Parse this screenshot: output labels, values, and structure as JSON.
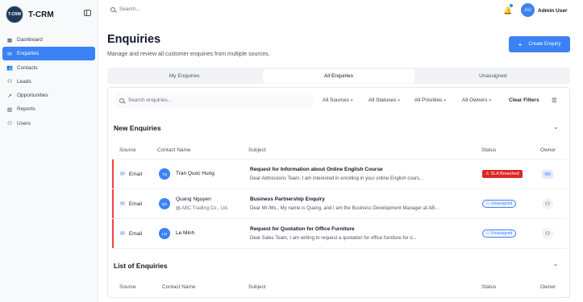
{
  "app": {
    "name": "T-CRM",
    "logo_text": "T-CRM"
  },
  "sidebar": {
    "items": [
      {
        "label": "Dashboard",
        "icon": "dashboard-icon",
        "active": false
      },
      {
        "label": "Enquiries",
        "icon": "enquiries-icon",
        "active": true
      },
      {
        "label": "Contacts",
        "icon": "contacts-icon",
        "active": false
      },
      {
        "label": "Leads",
        "icon": "leads-icon",
        "active": false
      },
      {
        "label": "Opportunities",
        "icon": "opportunities-icon",
        "active": false
      },
      {
        "label": "Reports",
        "icon": "reports-icon",
        "active": false
      },
      {
        "label": "Users",
        "icon": "users-icon",
        "active": false
      }
    ]
  },
  "topbar": {
    "search_placeholder": "Search...",
    "user_initials": "AU",
    "user_name": "Admin User"
  },
  "page": {
    "title": "Enquiries",
    "subtitle": "Manage and review all customer enquiries from multiple sources.",
    "create_label": "Create Enquiry"
  },
  "tabs": [
    {
      "label": "My Enquiries",
      "active": false
    },
    {
      "label": "All Enquiries",
      "active": true
    },
    {
      "label": "Unassigned",
      "active": false
    }
  ],
  "filters": {
    "search_placeholder": "Search enquiries...",
    "sources": "All Sources",
    "statuses": "All Statuses",
    "priorities": "All Priorities",
    "owners": "All Owners",
    "clear": "Clear Filters"
  },
  "new_section": {
    "title": "New Enquiries"
  },
  "list_section": {
    "title": "List of Enquiries"
  },
  "columns": {
    "source": "Source",
    "contact": "Contact Name",
    "subject": "Subject",
    "status": "Status",
    "owner": "Owner"
  },
  "rows": [
    {
      "source": "Email",
      "initials": "TQ",
      "contact": "Tran Quoc Hung",
      "company": "",
      "subject": "Request for Information about Online English Course",
      "preview": "Dear Admissions Team, I am interested in enrolling in your online English cours...",
      "status": "SLA Breached",
      "owner": "NN"
    },
    {
      "source": "Email",
      "initials": "QN",
      "contact": "Quang Nguyen",
      "company": "ABC Trading Co., Ltd.",
      "subject": "Business Partnership Enquiry",
      "preview": "Dear Mr./Ms., My name is Quang, and I am the Business Development Manager at AB...",
      "status": "Unassigned",
      "owner": ""
    },
    {
      "source": "Email",
      "initials": "LM",
      "contact": "Le Minh",
      "company": "",
      "subject": "Request for Quotation for Office Furniture",
      "preview": "Dear Sales Team, I am writing to request a quotation for office furniture for o...",
      "status": "Unassigned",
      "owner": ""
    }
  ]
}
